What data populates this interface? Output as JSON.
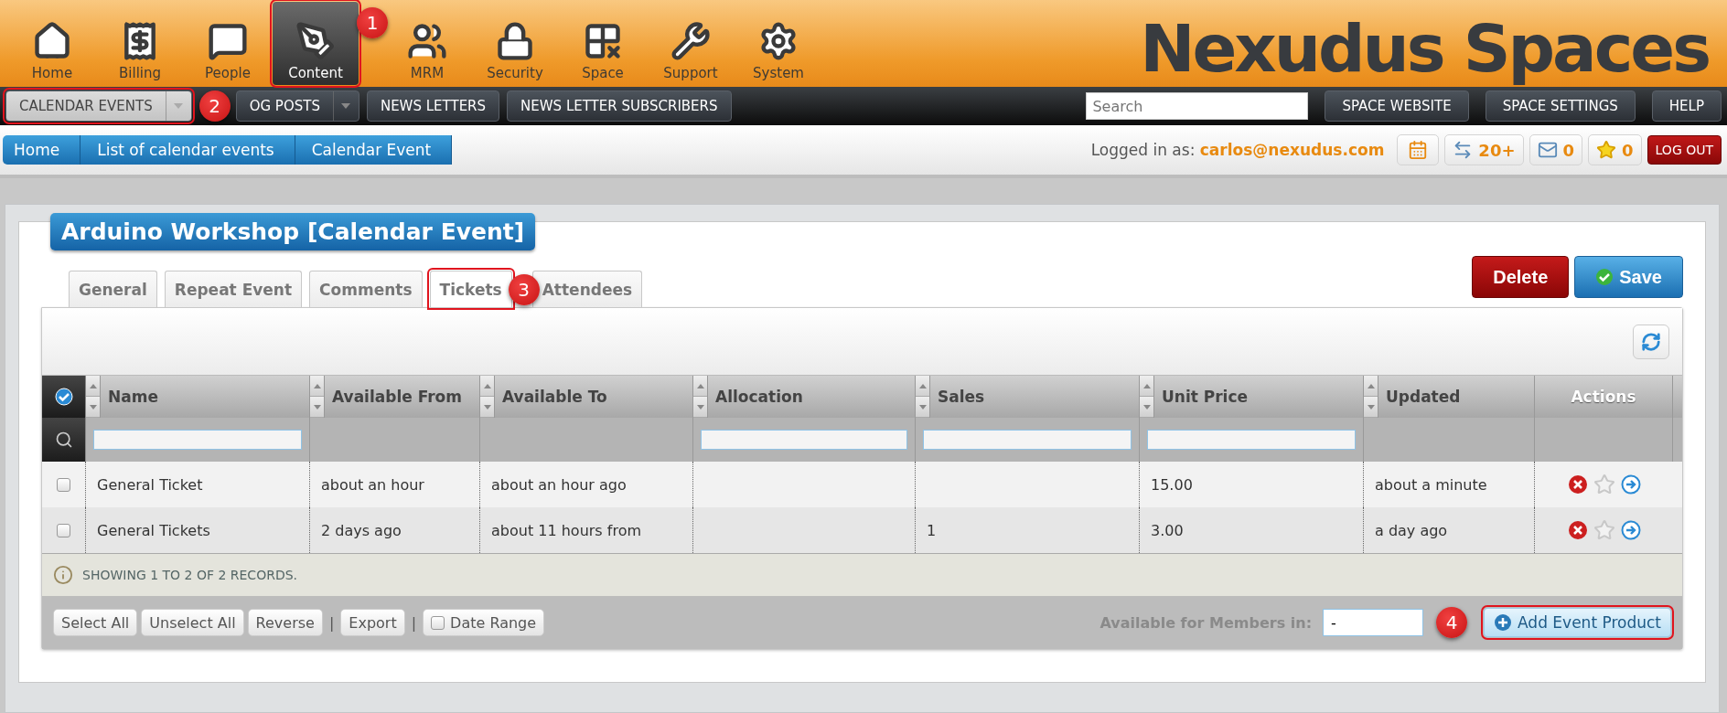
{
  "nav": [
    {
      "label": "Home",
      "selected": false,
      "highlighted": false
    },
    {
      "label": "Billing",
      "selected": false,
      "highlighted": false
    },
    {
      "label": "People",
      "selected": false,
      "highlighted": false
    },
    {
      "label": "Content",
      "selected": true,
      "highlighted": true,
      "marker": "1"
    },
    {
      "label": "MRM",
      "selected": false,
      "highlighted": false
    },
    {
      "label": "Security",
      "selected": false,
      "highlighted": false
    },
    {
      "label": "Space",
      "selected": false,
      "highlighted": false
    },
    {
      "label": "Support",
      "selected": false,
      "highlighted": false
    },
    {
      "label": "System",
      "selected": false,
      "highlighted": false
    }
  ],
  "logo": "Nexudus Spaces",
  "subnav": [
    {
      "label": "CALENDAR EVENTS",
      "kind": "dropdown",
      "selected": true,
      "highlighted": true,
      "marker": "2"
    },
    {
      "label": "OG POSTS",
      "kind": "dropdown",
      "selected": false,
      "highlighted": false
    },
    {
      "label": "NEWS LETTERS",
      "kind": "button",
      "selected": false,
      "highlighted": false
    },
    {
      "label": "NEWS LETTER SUBSCRIBERS",
      "kind": "button",
      "selected": false,
      "highlighted": false
    }
  ],
  "search": {
    "placeholder": "Search"
  },
  "top_buttons": [
    "SPACE WEBSITE",
    "SPACE SETTINGS",
    "HELP"
  ],
  "breadcrumb": [
    "Home",
    "List of calendar events",
    "Calendar Event"
  ],
  "user": {
    "prefix": "Logged in as:",
    "email": "carlos@nexudus.com"
  },
  "counters": [
    {
      "kind": "calendar"
    },
    {
      "kind": "messages",
      "count": "20+"
    },
    {
      "kind": "mail",
      "count": "0"
    },
    {
      "kind": "star",
      "count": "0"
    }
  ],
  "logout": "LOG OUT",
  "title": "Arduino Workshop [Calendar Event]",
  "actions": [
    {
      "label": "Delete",
      "kind": "danger"
    },
    {
      "label": "Save",
      "kind": "primary"
    }
  ],
  "tabs": [
    {
      "label": "General",
      "selected": false,
      "highlighted": false
    },
    {
      "label": "Repeat Event",
      "selected": false,
      "highlighted": false
    },
    {
      "label": "Comments",
      "selected": false,
      "highlighted": false
    },
    {
      "label": "Tickets",
      "selected": true,
      "highlighted": true,
      "marker": "3"
    },
    {
      "label": "Attendees",
      "selected": false,
      "highlighted": false
    }
  ],
  "table": {
    "columns": [
      {
        "label": "Name",
        "sortable": true,
        "filter": true
      },
      {
        "label": "Available From",
        "sortable": true,
        "filter": false
      },
      {
        "label": "Available To",
        "sortable": true,
        "filter": false
      },
      {
        "label": "Allocation",
        "sortable": true,
        "filter": true
      },
      {
        "label": "Sales",
        "sortable": true,
        "filter": true
      },
      {
        "label": "Unit Price",
        "sortable": true,
        "filter": true
      },
      {
        "label": "Updated",
        "sortable": true,
        "filter": false
      },
      {
        "label": "Actions",
        "sortable": false,
        "filter": false
      }
    ],
    "rows": [
      {
        "checked": false,
        "starred": false,
        "cells": [
          "General Ticket",
          "about an hour",
          "about an hour ago",
          "",
          "",
          "15.00",
          "about a minute"
        ]
      },
      {
        "checked": false,
        "starred": false,
        "cells": [
          "General Tickets",
          "2 days ago",
          "about 11 hours from",
          "",
          "1",
          "3.00",
          "a day ago"
        ]
      }
    ],
    "info": "SHOWING 1 TO 2 OF 2 RECORDS."
  },
  "footer": {
    "buttons": [
      {
        "kind": "button",
        "label": "Select All"
      },
      {
        "kind": "button",
        "label": "Unselect All"
      },
      {
        "kind": "button",
        "label": "Reverse"
      },
      {
        "kind": "separator",
        "label": "|"
      },
      {
        "kind": "button",
        "label": "Export"
      },
      {
        "kind": "separator",
        "label": "|"
      },
      {
        "kind": "checkbox",
        "label": "Date Range",
        "checked": false
      }
    ],
    "members_label": "Available for Members in:",
    "members_value": "-",
    "add_button": {
      "label": "Add Event Product",
      "highlighted": true,
      "marker": "4"
    }
  }
}
